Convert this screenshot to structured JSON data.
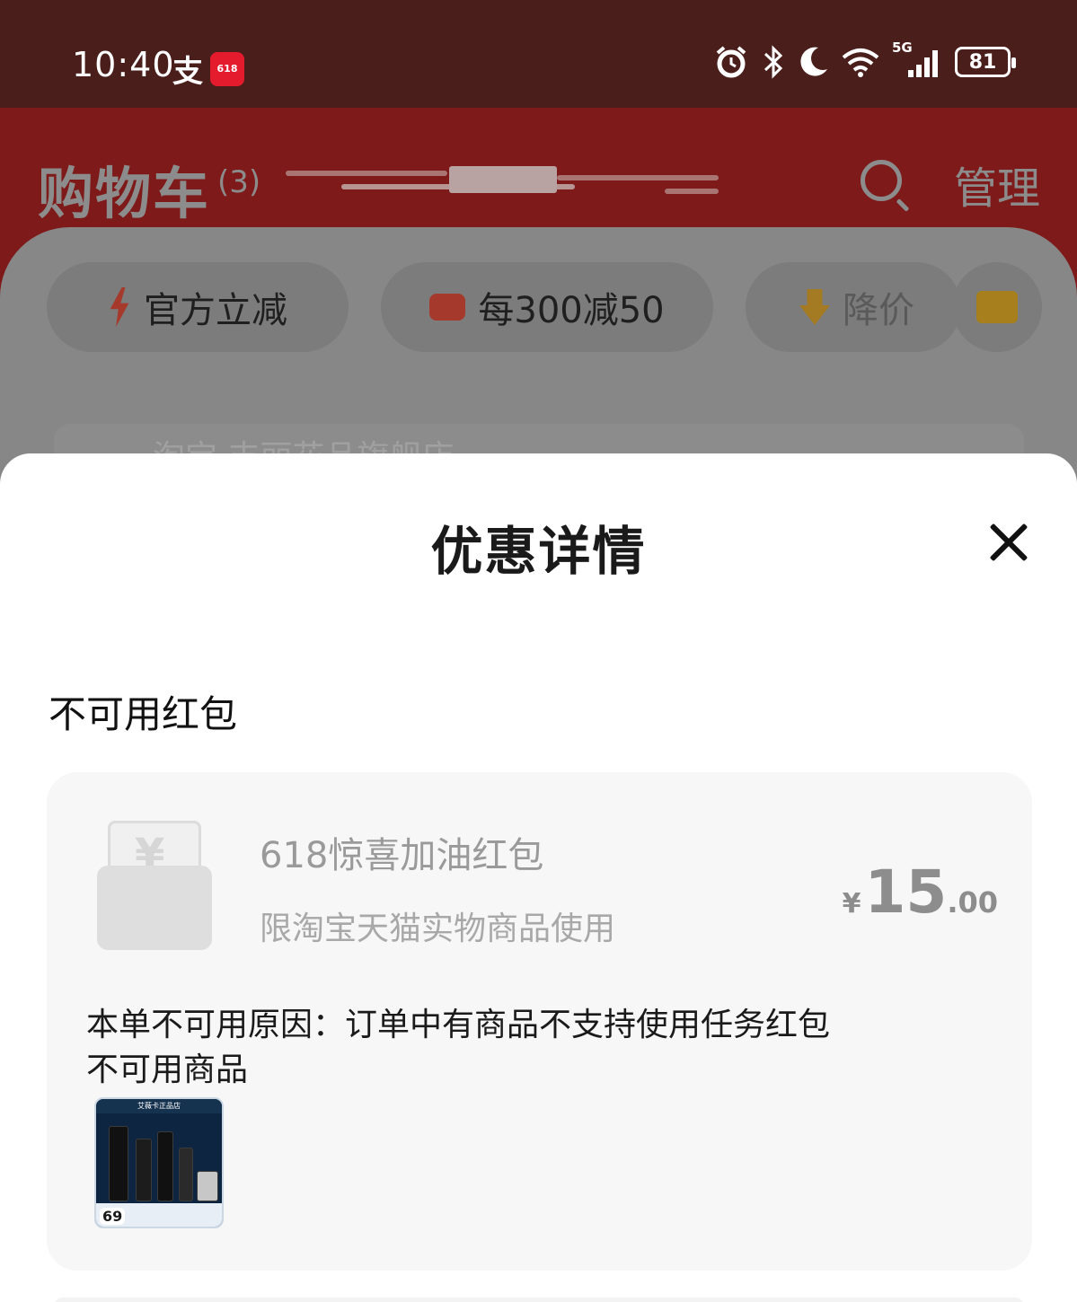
{
  "status_bar": {
    "time": "10:40",
    "alipay_glyph": "支",
    "app_badge": "618",
    "network_label": "5G",
    "battery": "81"
  },
  "background": {
    "cart_title": "购物车",
    "cart_count": "(3)",
    "manage_label": "管理",
    "chips": [
      "官方立减",
      "每300减50",
      "降价"
    ],
    "store_peek": "淘宝 丰丽花品旗舰店"
  },
  "sheet": {
    "title": "优惠详情",
    "section_title": "不可用红包",
    "coupon": {
      "name": "618惊喜加油红包",
      "description": "限淘宝天猫实物商品使用",
      "currency": "¥",
      "amount_int": "15",
      "amount_dec": ".00",
      "icon_symbol": "¥"
    },
    "reason": "本单不可用原因：订单中有商品不支持使用任务红包",
    "unavailable_label": "不可用商品",
    "product": {
      "store_name": "艾薇卡正品店",
      "price": "69"
    }
  },
  "icons": [
    "alipay-icon",
    "alarm-icon",
    "bluetooth-icon",
    "moon-icon",
    "wifi-icon",
    "signal-icon",
    "battery-icon",
    "search-icon",
    "close-icon",
    "bolt-icon",
    "shop-icon",
    "price-down-icon",
    "folder-icon",
    "wallet-icon"
  ]
}
